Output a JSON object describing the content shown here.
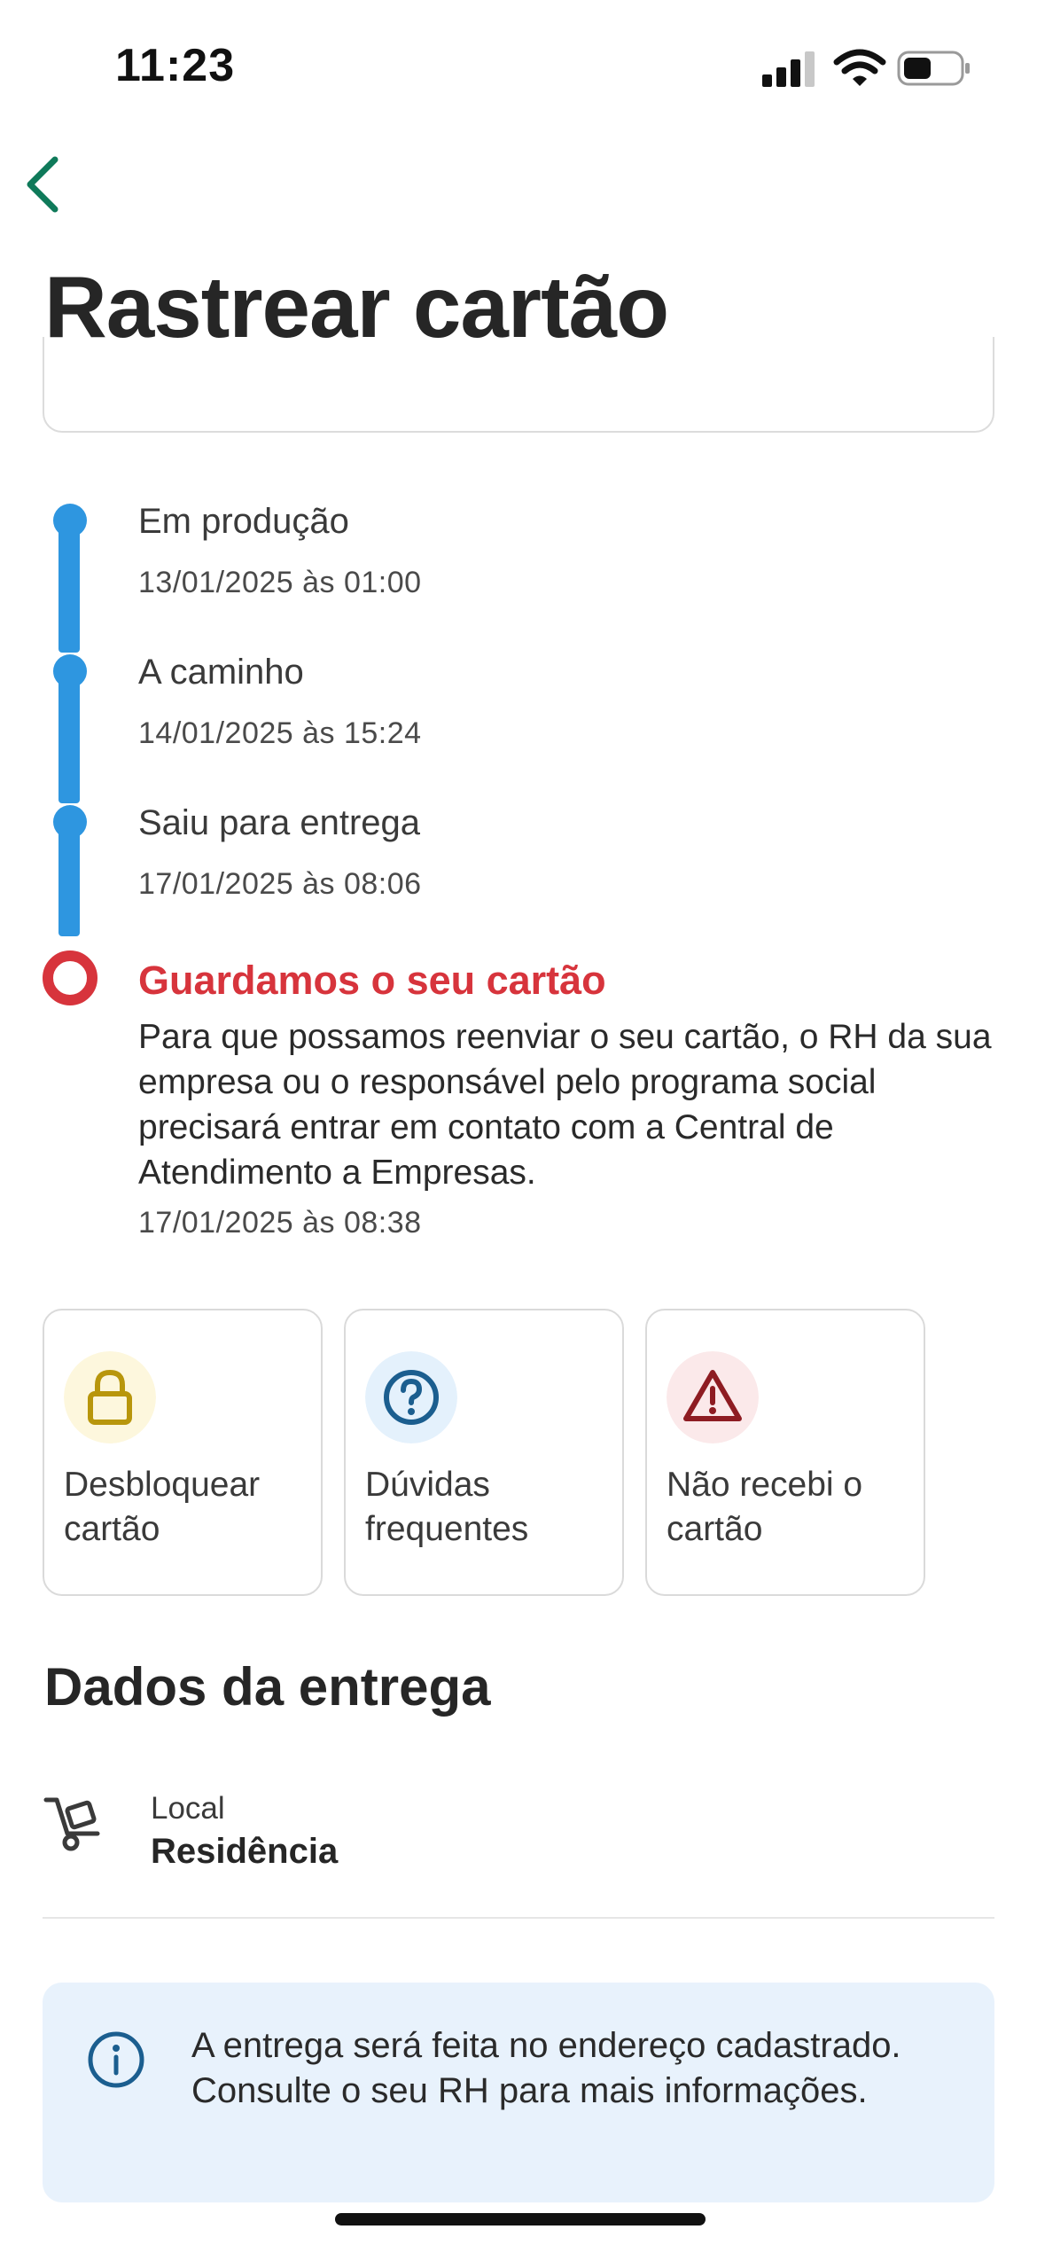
{
  "status_bar": {
    "time": "11:23"
  },
  "header": {
    "title": "Rastrear cartão"
  },
  "timeline": [
    {
      "title": "Em produção",
      "date": "13/01/2025 às 01:00"
    },
    {
      "title": "A caminho",
      "date": "14/01/2025 às 15:24"
    },
    {
      "title": "Saiu para entrega",
      "date": "17/01/2025 às 08:06"
    }
  ],
  "timeline_alert": {
    "title": "Guardamos o seu cartão",
    "description": "Para que possamos reenviar o seu cartão, o RH da sua empresa ou o responsável pelo programa social precisará entrar em contato com a Central de Atendimento a Empresas.",
    "date": "17/01/2025 às 08:38"
  },
  "shortcuts": [
    {
      "label": "Desbloquear cartão",
      "icon": "lock-icon",
      "color": "#b8960c",
      "bg": "#fdf7dd"
    },
    {
      "label": "Dúvidas frequentes",
      "icon": "question-icon",
      "color": "#1b5e8f",
      "bg": "#e4f1fc"
    },
    {
      "label": "Não recebi o cartão",
      "icon": "warning-icon",
      "color": "#8e1c22",
      "bg": "#fbe9ea"
    }
  ],
  "delivery": {
    "title": "Dados da entrega",
    "local_label": "Local",
    "local_value": "Residência",
    "info": "A entrega será feita no endereço cadastrado. Consulte o seu RH para mais informações."
  },
  "colors": {
    "progress": "#2e96e0",
    "alert": "#d7343c",
    "back": "#0f7a5a",
    "info_bg": "#e8f2fc"
  }
}
